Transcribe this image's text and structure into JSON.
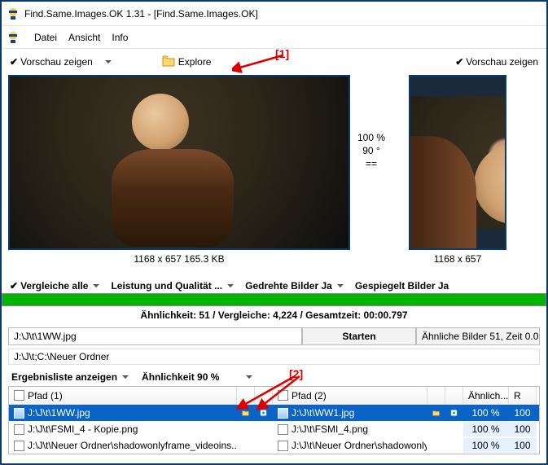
{
  "window": {
    "title": "Find.Same.Images.OK 1.31 - [Find.Same.Images.OK]"
  },
  "menu": {
    "file": "Datei",
    "view": "Ansicht",
    "info": "Info"
  },
  "toolbar": {
    "left": {
      "show_preview": "Vorschau zeigen",
      "explore": "Explore"
    },
    "right": {
      "show_preview": "Vorschau zeigen"
    }
  },
  "compare": {
    "percent": "100 %",
    "rotation": "90 °",
    "eq": "=="
  },
  "preview": {
    "left_caption": "1168 x 657 165.3 KB",
    "right_caption": "1168 x 657"
  },
  "options": {
    "compare_all": "Vergleiche alle",
    "perf_quality": "Leistung und Qualität ...",
    "rotated": "Gedrehte Bilder Ja",
    "mirrored": "Gespiegelt Bilder Ja"
  },
  "status": "Ähnlichkeit: 51 / Vergleiche: 4,224 / Gesamtzeit: 00:00.797",
  "pathrow": {
    "path": "J:\\J\\t\\1WW.jpg",
    "start": "Starten",
    "info": "Ähnliche Bilder 51, Zeit 0.0"
  },
  "path2": "J:\\J\\t;C:\\Neuer Ordner",
  "filters": {
    "show_results": "Ergebnisliste anzeigen",
    "similarity": "Ähnlichkeit 90 %"
  },
  "grid": {
    "head": {
      "path1": "Pfad (1)",
      "path2": "Pfad (2)",
      "similar": "Ähnlich...",
      "r": "R"
    },
    "rows": [
      {
        "p1": "J:\\J\\t\\1WW.jpg",
        "p2": "J:\\J\\t\\WW1.jpg",
        "sim": "100 %",
        "r": "100"
      },
      {
        "p1": "J:\\J\\t\\FSMI_4 - Kopie.png",
        "p2": "J:\\J\\t\\FSMI_4.png",
        "sim": "100 %",
        "r": "100"
      },
      {
        "p1": "J:\\J\\t\\Neuer Ordner\\shadowonlyframe_videoins...",
        "p2": "J:\\J\\t\\Neuer Ordner\\shadowonlyframe_videoin...",
        "sim": "100 %",
        "r": "100"
      }
    ]
  },
  "annotations": {
    "a1": "[1]",
    "a2": "[2]"
  }
}
